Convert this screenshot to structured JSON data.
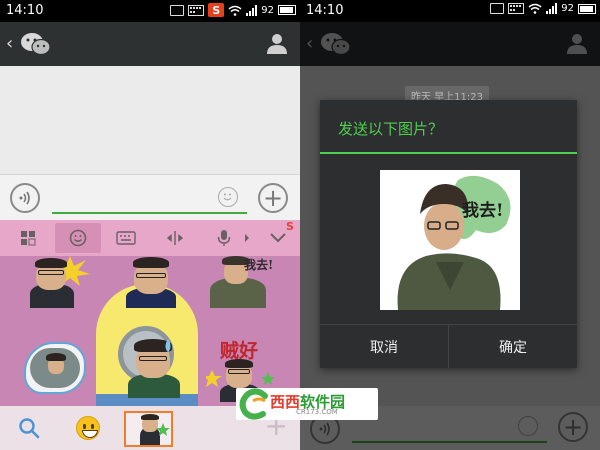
{
  "status_bar": {
    "time": "14:10",
    "battery": "92"
  },
  "chat_input": {
    "placeholder": ""
  },
  "dim_header": {
    "timestamp": "昨天 早上11:23"
  },
  "dialog": {
    "title": "发送以下图片？",
    "cancel_label": "取消",
    "confirm_label": "确定",
    "image_caption": "我去!"
  },
  "stickers": {
    "caption_hao": "贼好"
  },
  "watermark": {
    "brand_part1": "西西",
    "brand_part2": "软件园",
    "site": "CR173.COM"
  },
  "colors": {
    "accent_green": "#4fcf4f",
    "toolbar_pink": "#e7a7c9",
    "panel_pink": "#c786b3",
    "titlebar": "#2e3132",
    "selected_border": "#ef7d2a"
  },
  "icons": {
    "titlebar": [
      "back-chevron-icon",
      "wechat-logo-icon",
      "person-icon"
    ],
    "keyboard_toolbar": [
      "grid-icon",
      "emoji-icon",
      "keyboard-icon",
      "cursor-icon",
      "microphone-icon",
      "chevron-right-icon",
      "chevron-down-icon"
    ],
    "emoji_bar": [
      "search-icon",
      "smiley-emoji-icon",
      "add-icon"
    ]
  }
}
